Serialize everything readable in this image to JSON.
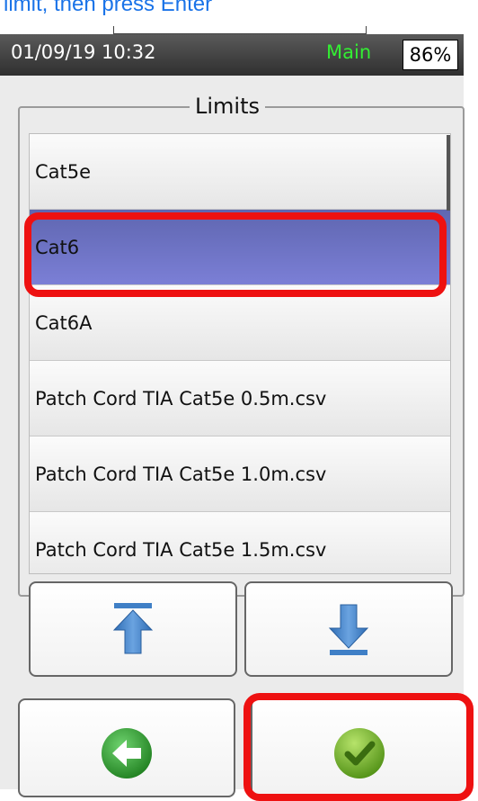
{
  "instruction": "limit, then press Enter",
  "status_bar": {
    "datetime": "01/09/19 10:32",
    "mode": "Main",
    "battery": "86%"
  },
  "limits": {
    "title": "Limits",
    "items": [
      {
        "label": "Cat5e",
        "selected": false
      },
      {
        "label": "Cat6",
        "selected": true
      },
      {
        "label": "Cat6A",
        "selected": false
      },
      {
        "label": "Patch Cord TIA Cat5e 0.5m.csv",
        "selected": false
      },
      {
        "label": "Patch Cord TIA Cat5e 1.0m.csv",
        "selected": false
      },
      {
        "label": "Patch Cord TIA Cat5e 1.5m.csv",
        "selected": false
      }
    ]
  },
  "buttons": {
    "scroll_top": {
      "icon": "scroll-to-top-icon"
    },
    "scroll_bottom": {
      "icon": "scroll-to-bottom-icon"
    },
    "back": {
      "icon": "back-arrow-icon"
    },
    "ok": {
      "icon": "checkmark-icon"
    }
  },
  "colors": {
    "selection": "#6f74c8",
    "highlight": "#ee1111",
    "mode": "#33ee33",
    "arrow": "#3f7fc6",
    "back": "#2e9e2e",
    "ok": "#6aae22"
  }
}
